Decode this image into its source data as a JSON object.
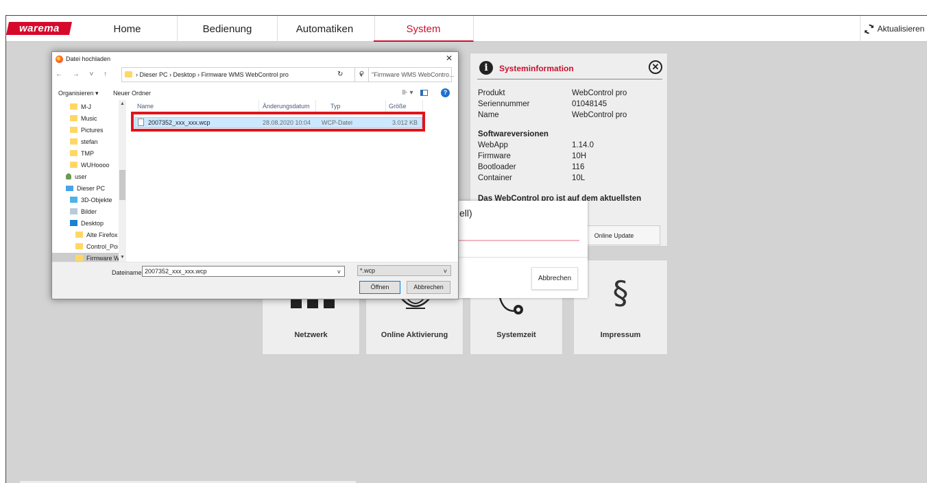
{
  "nav": {
    "logo": "warema",
    "tabs": [
      "Home",
      "Bedienung",
      "Automatiken",
      "System"
    ],
    "refresh_label": "Aktualisieren"
  },
  "tiles": {
    "network": "Netzwerk",
    "online_activation": "Online Aktivierung",
    "system_time": "Systemzeit",
    "imprint": "Impressum",
    "imprint_symbol": "§"
  },
  "sysinfo": {
    "icon": "i",
    "title": "Systeminformation",
    "close": "✕",
    "rows": [
      {
        "label": "Produkt",
        "value": "WebControl pro"
      },
      {
        "label": "Seriennummer",
        "value": "01048145"
      },
      {
        "label": "Name",
        "value": "WebControl pro"
      }
    ],
    "software_heading": "Softwareversionen",
    "versions": [
      {
        "label": "WebApp",
        "value": "1.14.0"
      },
      {
        "label": "Firmware",
        "value": "10H"
      },
      {
        "label": "Bootloader",
        "value": "116"
      },
      {
        "label": "Container",
        "value": "10L"
      }
    ],
    "status_text": "Das WebControl pro ist auf dem aktuellsten",
    "online_update": "Online Update"
  },
  "progress_dialog": {
    "title_fragment": "ell)",
    "cancel": "Abbrechen"
  },
  "file_dialog": {
    "title": "Datei hochladen",
    "close": "✕",
    "nav_arrows": "← → ˅ ↑",
    "path": "› Dieser PC › Desktop › Firmware WMS WebControl pro",
    "path_chevron": "˅",
    "reload": "↻",
    "search_icon": "⚲",
    "search_placeholder": "\"Firmware WMS WebContro...",
    "organize": "Organisieren ▾",
    "new_folder": "Neuer Ordner",
    "view_toggle": "⊪ ▾",
    "help": "?",
    "tree": [
      "M-J",
      "Music",
      "Pictures",
      "stefan",
      "TMP",
      "WUHoooo",
      "user",
      "Dieser PC",
      "3D-Objekte",
      "Bilder",
      "Desktop",
      "Alte Firefox-D",
      "Control_Porta",
      "Firmware WN"
    ],
    "columns": {
      "name": "Name",
      "modified": "Änderungsdatum",
      "type": "Typ",
      "size": "Größe"
    },
    "files": [
      {
        "name": "2007352_xxx_xxx.wcp",
        "modified": "28.08.2020 10:04",
        "type": "WCP-Datei",
        "size": "3.012 KB"
      }
    ],
    "filename_label": "Dateiname:",
    "filename_value": "2007352_xxx_xxx.wcp",
    "filter_value": "*.wcp",
    "dropdown_chevron": "˅",
    "open_button": "Öffnen",
    "cancel_button": "Abbrechen"
  }
}
